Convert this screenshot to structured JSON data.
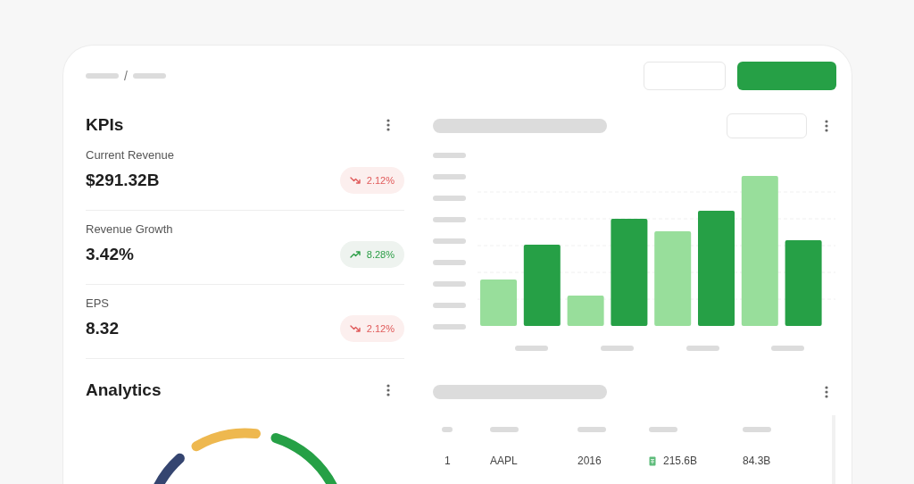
{
  "breadcrumb": {
    "separator": "/"
  },
  "kpis": {
    "title": "KPIs",
    "items": [
      {
        "label": "Current Revenue",
        "value": "$291.32B",
        "change": "2.12%",
        "kind": "down"
      },
      {
        "label": "Revenue Growth",
        "value": "3.42%",
        "change": "8.28%",
        "kind": "up"
      },
      {
        "label": "EPS",
        "value": "8.32",
        "change": "2.12%",
        "kind": "down"
      }
    ]
  },
  "analytics": {
    "title": "Analytics"
  },
  "table": {
    "rows": [
      {
        "cells": [
          {
            "kind": "text",
            "text": "1"
          },
          {
            "kind": "text",
            "text": "AAPL"
          },
          {
            "kind": "text",
            "text": "2016"
          },
          {
            "kind": "icon_text",
            "text": "215.6B"
          },
          {
            "kind": "text",
            "text": "84.3B"
          }
        ]
      }
    ]
  }
}
